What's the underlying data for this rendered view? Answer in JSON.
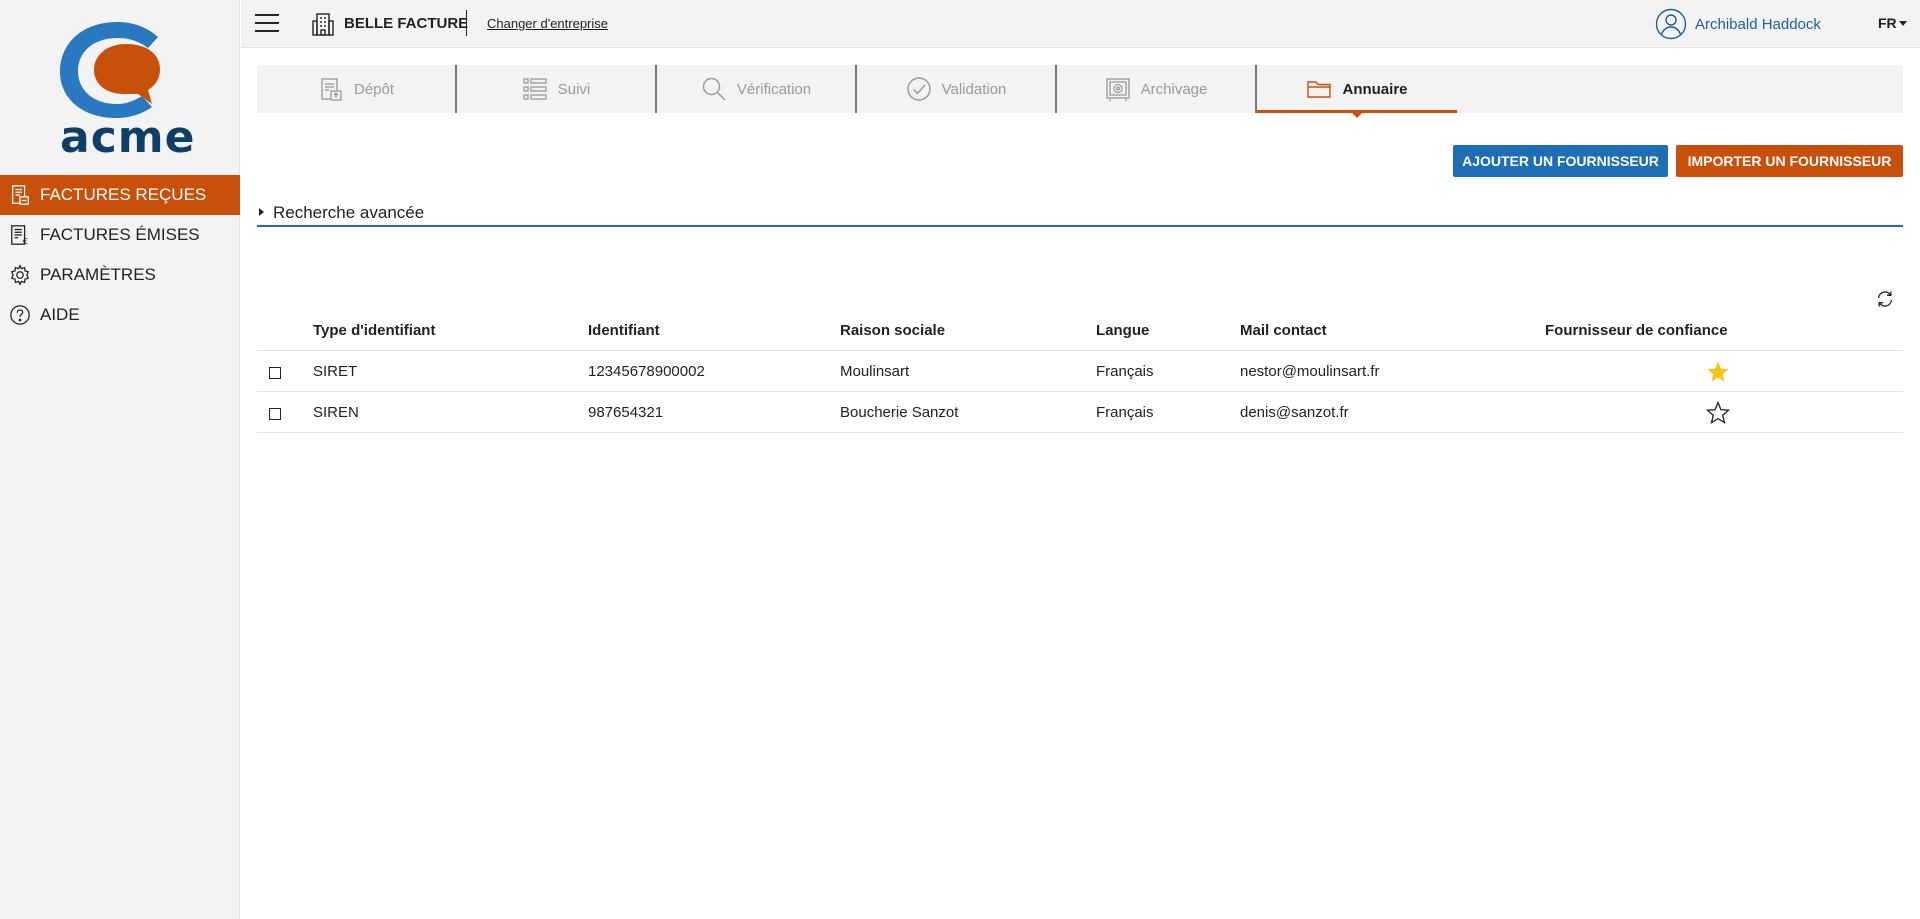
{
  "sidebar": {
    "logo_text": "acme",
    "items": [
      {
        "label": "FACTURES REÇUES",
        "icon": "invoice-received-icon",
        "active": true
      },
      {
        "label": "FACTURES ÉMISES",
        "icon": "invoice-issued-icon",
        "active": false
      },
      {
        "label": "PARAMÈTRES",
        "icon": "gear-icon",
        "active": false
      },
      {
        "label": "AIDE",
        "icon": "help-icon",
        "active": false
      }
    ]
  },
  "header": {
    "company_name": "BELLE FACTURE",
    "change_company": "Changer d'entreprise",
    "user_name": "Archibald Haddock",
    "language": "FR"
  },
  "tabs": [
    {
      "label": "Dépôt",
      "icon": "deposit-icon"
    },
    {
      "label": "Suivi",
      "icon": "tracking-list-icon"
    },
    {
      "label": "Vérification",
      "icon": "search-icon"
    },
    {
      "label": "Validation",
      "icon": "check-circle-icon"
    },
    {
      "label": "Archivage",
      "icon": "safe-icon"
    },
    {
      "label": "Annuaire",
      "icon": "folder-icon",
      "active": true
    }
  ],
  "actions": {
    "add_supplier": "AJOUTER UN FOURNISSEUR",
    "import_supplier": "IMPORTER UN FOURNISSEUR"
  },
  "advanced_search": {
    "label": "Recherche avancée"
  },
  "table": {
    "columns": [
      "Type d'identifiant",
      "Identifiant",
      "Raison sociale",
      "Langue",
      "Mail contact",
      "Fournisseur de confiance"
    ],
    "rows": [
      {
        "type": "SIRET",
        "id": "12345678900002",
        "raison": "Moulinsart",
        "langue": "Français",
        "mail": "nestor@moulinsart.fr",
        "trusted": true
      },
      {
        "type": "SIREN",
        "id": "987654321",
        "raison": "Boucherie Sanzot",
        "langue": "Français",
        "mail": "denis@sanzot.fr",
        "trusted": false
      }
    ]
  },
  "colors": {
    "accent_orange": "#c8500a",
    "accent_blue": "#1e6eb5",
    "star_gold": "#f5c518",
    "logo_blue": "#2a78c0"
  }
}
